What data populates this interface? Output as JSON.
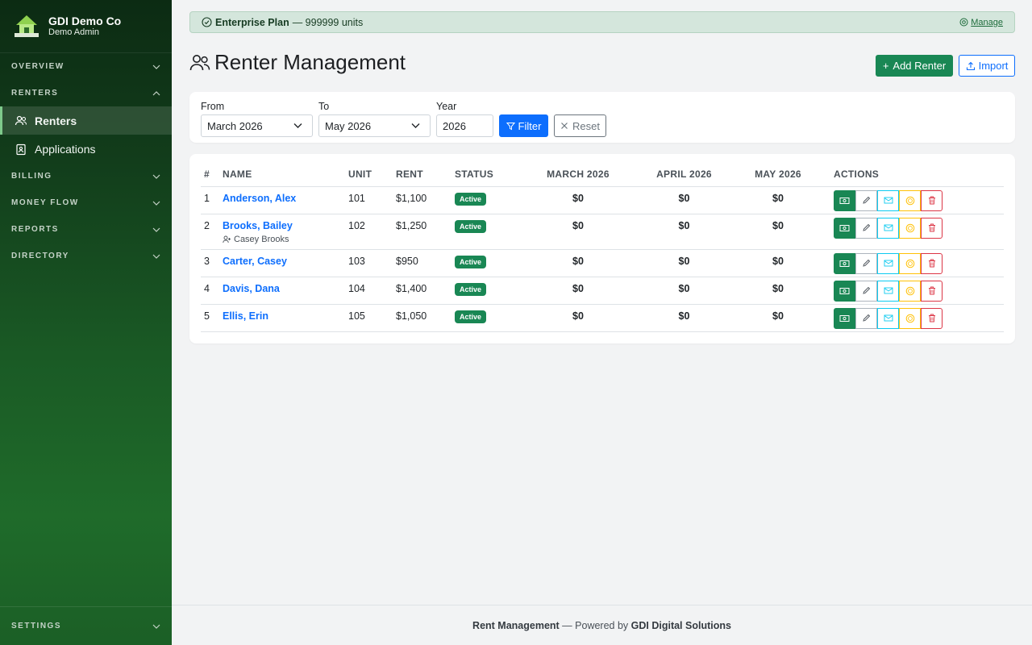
{
  "brand": {
    "company": "GDI Demo Co",
    "user": "Demo Admin"
  },
  "sidebar": {
    "sections": [
      {
        "label": "OVERVIEW",
        "expanded": false
      },
      {
        "label": "RENTERS",
        "expanded": true
      },
      {
        "label": "BILLING",
        "expanded": false
      },
      {
        "label": "MONEY FLOW",
        "expanded": false
      },
      {
        "label": "REPORTS",
        "expanded": false
      },
      {
        "label": "DIRECTORY",
        "expanded": false
      }
    ],
    "renter_items": [
      {
        "label": "Renters",
        "icon": "people-icon",
        "active": true
      },
      {
        "label": "Applications",
        "icon": "clipboard-icon",
        "active": false
      }
    ],
    "settings": "SETTINGS"
  },
  "banner": {
    "plan": "Enterprise Plan",
    "units": "— 999999 units",
    "manage": "Manage"
  },
  "page": {
    "title": "Renter Management",
    "add_label": "Add Renter",
    "import_label": "Import"
  },
  "filters": {
    "from_label": "From",
    "from_value": "March 2026",
    "to_label": "To",
    "to_value": "May 2026",
    "year_label": "Year",
    "year_value": "2026",
    "filter_label": "Filter",
    "reset_label": "Reset"
  },
  "table": {
    "headers": [
      "#",
      "NAME",
      "UNIT",
      "RENT",
      "STATUS",
      "MARCH 2026",
      "APRIL 2026",
      "MAY 2026",
      "ACTIONS"
    ],
    "rows": [
      {
        "num": "1",
        "name": "Anderson, Alex",
        "co": "",
        "unit": "101",
        "rent": "$1,100",
        "status": "Active",
        "m1": "$0",
        "m2": "$0",
        "m3": "$0"
      },
      {
        "num": "2",
        "name": "Brooks, Bailey",
        "co": "Casey Brooks",
        "unit": "102",
        "rent": "$1,250",
        "status": "Active",
        "m1": "$0",
        "m2": "$0",
        "m3": "$0"
      },
      {
        "num": "3",
        "name": "Carter, Casey",
        "co": "",
        "unit": "103",
        "rent": "$950",
        "status": "Active",
        "m1": "$0",
        "m2": "$0",
        "m3": "$0"
      },
      {
        "num": "4",
        "name": "Davis, Dana",
        "co": "",
        "unit": "104",
        "rent": "$1,400",
        "status": "Active",
        "m1": "$0",
        "m2": "$0",
        "m3": "$0"
      },
      {
        "num": "5",
        "name": "Ellis, Erin",
        "co": "",
        "unit": "105",
        "rent": "$1,050",
        "status": "Active",
        "m1": "$0",
        "m2": "$0",
        "m3": "$0"
      }
    ]
  },
  "footer": {
    "app": "Rent Management",
    "mid": " — Powered by ",
    "company": "GDI Digital Solutions"
  },
  "colors": {
    "success": "#198754",
    "primary": "#0d6efd",
    "info": "#0dcaf0",
    "warning": "#ffc107",
    "danger": "#dc3545"
  }
}
